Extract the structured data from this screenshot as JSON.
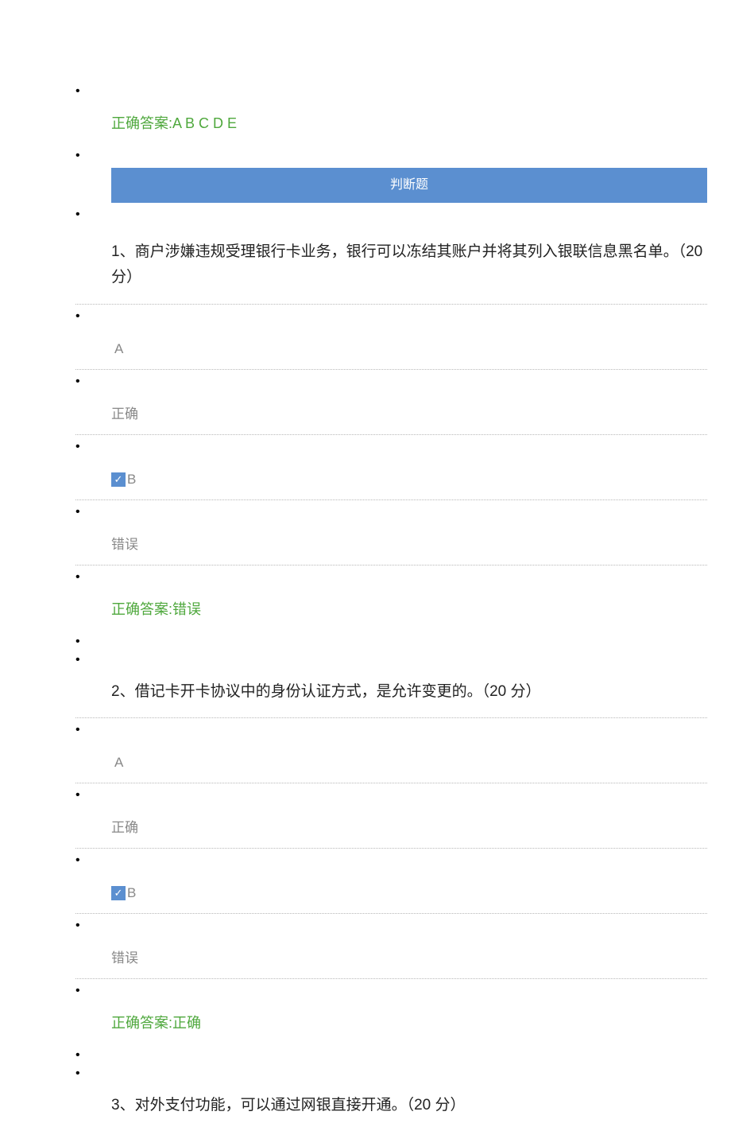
{
  "previousAnswer": {
    "label": "正确答案:",
    "value": "A B C D E"
  },
  "sectionHeader": "判断题",
  "questions": [
    {
      "number": "1、",
      "text": "商户涉嫌违规受理银行卡业务，银行可以冻结其账户并将其列入银联信息黑名单。",
      "points": "（20   分）",
      "optionA": {
        "label": "A",
        "text": "正确",
        "selected": false
      },
      "optionB": {
        "label": "B",
        "text": "错误",
        "selected": true
      },
      "correctLabel": "正确答案:",
      "correctValue": "错误"
    },
    {
      "number": "2、",
      "text": "借记卡开卡协议中的身份认证方式，是允许变更的。",
      "points": "（20   分）",
      "optionA": {
        "label": "A",
        "text": "正确",
        "selected": false
      },
      "optionB": {
        "label": "B",
        "text": "错误",
        "selected": true
      },
      "correctLabel": "正确答案:",
      "correctValue": "正确"
    },
    {
      "number": "3、",
      "text": "对外支付功能，可以通过网银直接开通。",
      "points": "（20   分）"
    }
  ],
  "checkMark": "✓"
}
